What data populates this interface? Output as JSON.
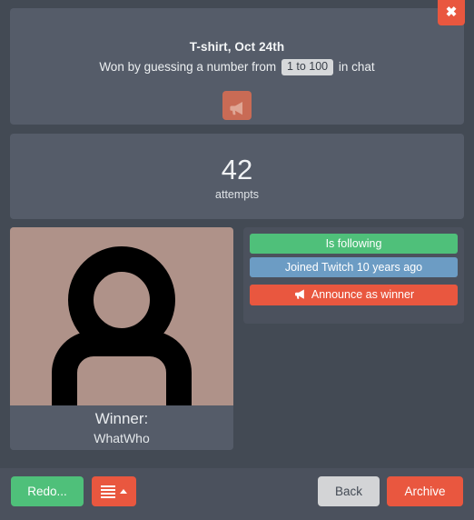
{
  "window": {
    "close_label": "✖"
  },
  "header": {
    "prize_title": "T-shirt, Oct 24th",
    "rule_prefix": "Won by guessing a number from",
    "range_tag": "1 to 100",
    "rule_suffix": "in chat",
    "announce_icon": "megaphone-icon"
  },
  "attempts": {
    "value": "42",
    "label": "attempts"
  },
  "winner": {
    "caption_title": "Winner:",
    "name": "WhatWho",
    "avatar_icon": "default-user-avatar-icon",
    "avatar_bg": "#af9289"
  },
  "side": {
    "badges": [
      {
        "label": "Is following",
        "color": "#4fc07a",
        "kind": "following"
      },
      {
        "label": "Joined Twitch 10 years ago",
        "color": "#6c9cc4",
        "kind": "joined"
      }
    ],
    "announce_label": "Announce as winner",
    "announce_icon": "megaphone-icon",
    "announce_color": "#e9573f"
  },
  "footer": {
    "redo_label": "Redo...",
    "menu_icon": "hamburger-menu-icon",
    "menu_caret_icon": "caret-up-icon",
    "back_label": "Back",
    "archive_label": "Archive"
  },
  "colors": {
    "page_bg": "#434a54",
    "panel_bg": "#555c69",
    "subpanel_bg": "#4b515d",
    "accent_orange": "#e9573f",
    "accent_green": "#4fc07a",
    "accent_blue": "#6c9cc4",
    "muted_orange": "#c96b55",
    "tag_bg": "#d6d8da",
    "back_btn_bg": "#d3d4d6"
  }
}
